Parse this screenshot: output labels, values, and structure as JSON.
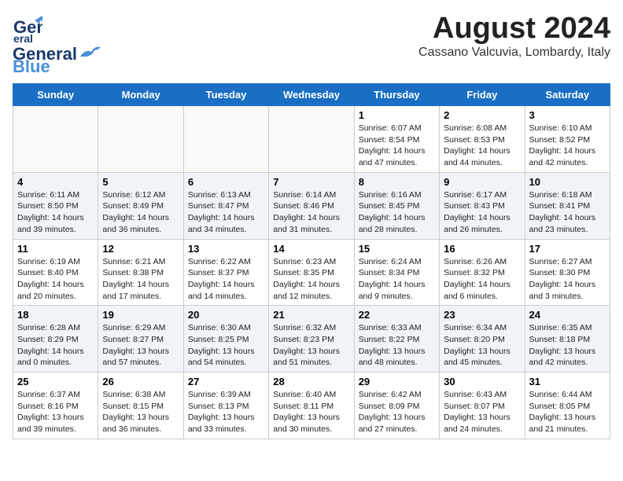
{
  "header": {
    "logo_line1": "General",
    "logo_line2": "Blue",
    "title": "August 2024",
    "subtitle": "Cassano Valcuvia, Lombardy, Italy"
  },
  "days_of_week": [
    "Sunday",
    "Monday",
    "Tuesday",
    "Wednesday",
    "Thursday",
    "Friday",
    "Saturday"
  ],
  "weeks": [
    [
      {
        "day": "",
        "info": ""
      },
      {
        "day": "",
        "info": ""
      },
      {
        "day": "",
        "info": ""
      },
      {
        "day": "",
        "info": ""
      },
      {
        "day": "1",
        "info": "Sunrise: 6:07 AM\nSunset: 8:54 PM\nDaylight: 14 hours and 47 minutes."
      },
      {
        "day": "2",
        "info": "Sunrise: 6:08 AM\nSunset: 8:53 PM\nDaylight: 14 hours and 44 minutes."
      },
      {
        "day": "3",
        "info": "Sunrise: 6:10 AM\nSunset: 8:52 PM\nDaylight: 14 hours and 42 minutes."
      }
    ],
    [
      {
        "day": "4",
        "info": "Sunrise: 6:11 AM\nSunset: 8:50 PM\nDaylight: 14 hours and 39 minutes."
      },
      {
        "day": "5",
        "info": "Sunrise: 6:12 AM\nSunset: 8:49 PM\nDaylight: 14 hours and 36 minutes."
      },
      {
        "day": "6",
        "info": "Sunrise: 6:13 AM\nSunset: 8:47 PM\nDaylight: 14 hours and 34 minutes."
      },
      {
        "day": "7",
        "info": "Sunrise: 6:14 AM\nSunset: 8:46 PM\nDaylight: 14 hours and 31 minutes."
      },
      {
        "day": "8",
        "info": "Sunrise: 6:16 AM\nSunset: 8:45 PM\nDaylight: 14 hours and 28 minutes."
      },
      {
        "day": "9",
        "info": "Sunrise: 6:17 AM\nSunset: 8:43 PM\nDaylight: 14 hours and 26 minutes."
      },
      {
        "day": "10",
        "info": "Sunrise: 6:18 AM\nSunset: 8:41 PM\nDaylight: 14 hours and 23 minutes."
      }
    ],
    [
      {
        "day": "11",
        "info": "Sunrise: 6:19 AM\nSunset: 8:40 PM\nDaylight: 14 hours and 20 minutes."
      },
      {
        "day": "12",
        "info": "Sunrise: 6:21 AM\nSunset: 8:38 PM\nDaylight: 14 hours and 17 minutes."
      },
      {
        "day": "13",
        "info": "Sunrise: 6:22 AM\nSunset: 8:37 PM\nDaylight: 14 hours and 14 minutes."
      },
      {
        "day": "14",
        "info": "Sunrise: 6:23 AM\nSunset: 8:35 PM\nDaylight: 14 hours and 12 minutes."
      },
      {
        "day": "15",
        "info": "Sunrise: 6:24 AM\nSunset: 8:34 PM\nDaylight: 14 hours and 9 minutes."
      },
      {
        "day": "16",
        "info": "Sunrise: 6:26 AM\nSunset: 8:32 PM\nDaylight: 14 hours and 6 minutes."
      },
      {
        "day": "17",
        "info": "Sunrise: 6:27 AM\nSunset: 8:30 PM\nDaylight: 14 hours and 3 minutes."
      }
    ],
    [
      {
        "day": "18",
        "info": "Sunrise: 6:28 AM\nSunset: 8:29 PM\nDaylight: 14 hours and 0 minutes."
      },
      {
        "day": "19",
        "info": "Sunrise: 6:29 AM\nSunset: 8:27 PM\nDaylight: 13 hours and 57 minutes."
      },
      {
        "day": "20",
        "info": "Sunrise: 6:30 AM\nSunset: 8:25 PM\nDaylight: 13 hours and 54 minutes."
      },
      {
        "day": "21",
        "info": "Sunrise: 6:32 AM\nSunset: 8:23 PM\nDaylight: 13 hours and 51 minutes."
      },
      {
        "day": "22",
        "info": "Sunrise: 6:33 AM\nSunset: 8:22 PM\nDaylight: 13 hours and 48 minutes."
      },
      {
        "day": "23",
        "info": "Sunrise: 6:34 AM\nSunset: 8:20 PM\nDaylight: 13 hours and 45 minutes."
      },
      {
        "day": "24",
        "info": "Sunrise: 6:35 AM\nSunset: 8:18 PM\nDaylight: 13 hours and 42 minutes."
      }
    ],
    [
      {
        "day": "25",
        "info": "Sunrise: 6:37 AM\nSunset: 8:16 PM\nDaylight: 13 hours and 39 minutes."
      },
      {
        "day": "26",
        "info": "Sunrise: 6:38 AM\nSunset: 8:15 PM\nDaylight: 13 hours and 36 minutes."
      },
      {
        "day": "27",
        "info": "Sunrise: 6:39 AM\nSunset: 8:13 PM\nDaylight: 13 hours and 33 minutes."
      },
      {
        "day": "28",
        "info": "Sunrise: 6:40 AM\nSunset: 8:11 PM\nDaylight: 13 hours and 30 minutes."
      },
      {
        "day": "29",
        "info": "Sunrise: 6:42 AM\nSunset: 8:09 PM\nDaylight: 13 hours and 27 minutes."
      },
      {
        "day": "30",
        "info": "Sunrise: 6:43 AM\nSunset: 8:07 PM\nDaylight: 13 hours and 24 minutes."
      },
      {
        "day": "31",
        "info": "Sunrise: 6:44 AM\nSunset: 8:05 PM\nDaylight: 13 hours and 21 minutes."
      }
    ]
  ]
}
